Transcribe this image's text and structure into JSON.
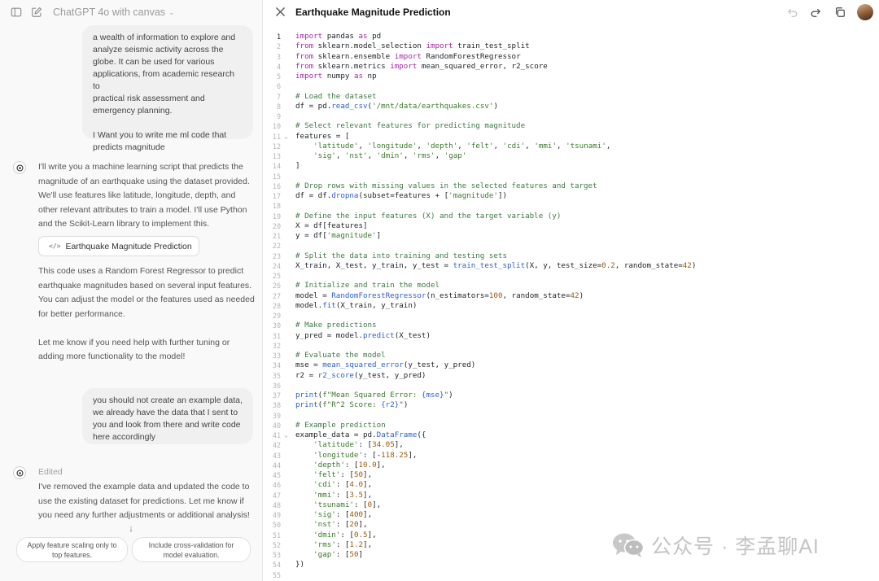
{
  "chat": {
    "model_title": "ChatGPT 4o with canvas",
    "user_message_1_lines": [
      "a wealth of information to explore and",
      "analyze seismic activity across the",
      "globe. It can be used for various",
      "applications, from academic research to",
      "practical risk assessment and",
      "emergency planning.",
      "",
      "I Want you to write me ml code that",
      "predicts magnitude"
    ],
    "assistant_message_1_lines": [
      "I'll write you a machine learning script that predicts the",
      "magnitude of an earthquake using the dataset provided.",
      "We'll use features like latitude, longitude, depth, and",
      "other relevant attributes to train a model. I'll use Python",
      "and the Scikit-Learn library to implement this."
    ],
    "canvas_chip_label": "Earthquake Magnitude Prediction",
    "assistant_message_2_lines": [
      "This code uses a Random Forest Regressor to predict",
      "earthquake magnitudes based on several input features.",
      "You can adjust the model or the features used as needed",
      "for better performance.",
      "",
      "Let me know if you need help with further tuning or",
      "adding more functionality to the model!"
    ],
    "user_message_2_lines": [
      "you should not create an example data,",
      "we already have the data that I sent to",
      "you and look from there and write code",
      "here accordingly"
    ],
    "edited_label": "Edited",
    "assistant_message_3_lines": [
      "I've removed the example data and updated the code to",
      "use the existing dataset for predictions. Let me know if",
      "you need any further adjustments or additional analysis!"
    ],
    "suggestions": [
      [
        "Apply feature scaling only to",
        "top features."
      ],
      [
        "Include cross-validation for",
        "model evaluation."
      ]
    ]
  },
  "canvas": {
    "title": "Earthquake Magnitude Prediction",
    "active_line": 1,
    "folded_lines": [
      11,
      41
    ],
    "code_lines": [
      [
        [
          "kw",
          "import"
        ],
        [
          "p",
          " pandas "
        ],
        [
          "kw",
          "as"
        ],
        [
          "p",
          " pd"
        ]
      ],
      [
        [
          "kw",
          "from"
        ],
        [
          "p",
          " sklearn.model_selection "
        ],
        [
          "kw",
          "import"
        ],
        [
          "p",
          " train_test_split"
        ]
      ],
      [
        [
          "kw",
          "from"
        ],
        [
          "p",
          " sklearn.ensemble "
        ],
        [
          "kw",
          "import"
        ],
        [
          "p",
          " RandomForestRegressor"
        ]
      ],
      [
        [
          "kw",
          "from"
        ],
        [
          "p",
          " sklearn.metrics "
        ],
        [
          "kw",
          "import"
        ],
        [
          "p",
          " mean_squared_error, r2_score"
        ]
      ],
      [
        [
          "kw",
          "import"
        ],
        [
          "p",
          " numpy "
        ],
        [
          "kw",
          "as"
        ],
        [
          "p",
          " np"
        ]
      ],
      [],
      [
        [
          "cm",
          "# Load the dataset"
        ]
      ],
      [
        [
          "p",
          "df = pd."
        ],
        [
          "fn",
          "read_csv"
        ],
        [
          "p",
          "("
        ],
        [
          "st",
          "'/mnt/data/earthquakes.csv'"
        ],
        [
          "p",
          ")"
        ]
      ],
      [],
      [
        [
          "cm",
          "# Select relevant features for predicting magnitude"
        ]
      ],
      [
        [
          "p",
          "features = ["
        ]
      ],
      [
        [
          "p",
          "    "
        ],
        [
          "st",
          "'latitude'"
        ],
        [
          "p",
          ", "
        ],
        [
          "st",
          "'longitude'"
        ],
        [
          "p",
          ", "
        ],
        [
          "st",
          "'depth'"
        ],
        [
          "p",
          ", "
        ],
        [
          "st",
          "'felt'"
        ],
        [
          "p",
          ", "
        ],
        [
          "st",
          "'cdi'"
        ],
        [
          "p",
          ", "
        ],
        [
          "st",
          "'mmi'"
        ],
        [
          "p",
          ", "
        ],
        [
          "st",
          "'tsunami'"
        ],
        [
          "p",
          ","
        ]
      ],
      [
        [
          "p",
          "    "
        ],
        [
          "st",
          "'sig'"
        ],
        [
          "p",
          ", "
        ],
        [
          "st",
          "'nst'"
        ],
        [
          "p",
          ", "
        ],
        [
          "st",
          "'dmin'"
        ],
        [
          "p",
          ", "
        ],
        [
          "st",
          "'rms'"
        ],
        [
          "p",
          ", "
        ],
        [
          "st",
          "'gap'"
        ]
      ],
      [
        [
          "p",
          "]"
        ]
      ],
      [],
      [
        [
          "cm",
          "# Drop rows with missing values in the selected features and target"
        ]
      ],
      [
        [
          "p",
          "df = df."
        ],
        [
          "fn",
          "dropna"
        ],
        [
          "p",
          "(subset=features + ["
        ],
        [
          "st",
          "'magnitude'"
        ],
        [
          "p",
          "])"
        ]
      ],
      [],
      [
        [
          "cm",
          "# Define the input features (X) and the target variable (y)"
        ]
      ],
      [
        [
          "p",
          "X = df[features]"
        ]
      ],
      [
        [
          "p",
          "y = df["
        ],
        [
          "st",
          "'magnitude'"
        ],
        [
          "p",
          "]"
        ]
      ],
      [],
      [
        [
          "cm",
          "# Split the data into training and testing sets"
        ]
      ],
      [
        [
          "p",
          "X_train, X_test, y_train, y_test = "
        ],
        [
          "fn",
          "train_test_split"
        ],
        [
          "p",
          "(X, y, test_size="
        ],
        [
          "num",
          "0.2"
        ],
        [
          "p",
          ", random_state="
        ],
        [
          "num",
          "42"
        ],
        [
          "p",
          ")"
        ]
      ],
      [],
      [
        [
          "cm",
          "# Initialize and train the model"
        ]
      ],
      [
        [
          "p",
          "model = "
        ],
        [
          "fn",
          "RandomForestRegressor"
        ],
        [
          "p",
          "(n_estimators="
        ],
        [
          "num",
          "100"
        ],
        [
          "p",
          ", random_state="
        ],
        [
          "num",
          "42"
        ],
        [
          "p",
          ")"
        ]
      ],
      [
        [
          "p",
          "model."
        ],
        [
          "fn",
          "fit"
        ],
        [
          "p",
          "(X_train, y_train)"
        ]
      ],
      [],
      [
        [
          "cm",
          "# Make predictions"
        ]
      ],
      [
        [
          "p",
          "y_pred = model."
        ],
        [
          "fn",
          "predict"
        ],
        [
          "p",
          "(X_test)"
        ]
      ],
      [],
      [
        [
          "cm",
          "# Evaluate the model"
        ]
      ],
      [
        [
          "p",
          "mse = "
        ],
        [
          "fn",
          "mean_squared_error"
        ],
        [
          "p",
          "(y_test, y_pred)"
        ]
      ],
      [
        [
          "p",
          "r2 = "
        ],
        [
          "fn",
          "r2_score"
        ],
        [
          "p",
          "(y_test, y_pred)"
        ]
      ],
      [],
      [
        [
          "fn",
          "print"
        ],
        [
          "p",
          "("
        ],
        [
          "st",
          "f\"Mean Squared Error: "
        ],
        [
          "fn",
          "{mse}"
        ],
        [
          "st",
          "\""
        ],
        [
          "p",
          ")"
        ]
      ],
      [
        [
          "fn",
          "print"
        ],
        [
          "p",
          "("
        ],
        [
          "st",
          "f\"R^2 Score: "
        ],
        [
          "fn",
          "{r2}"
        ],
        [
          "st",
          "\""
        ],
        [
          "p",
          ")"
        ]
      ],
      [],
      [
        [
          "cm",
          "# Example prediction"
        ]
      ],
      [
        [
          "p",
          "example_data = pd."
        ],
        [
          "fn",
          "DataFrame"
        ],
        [
          "p",
          "({"
        ]
      ],
      [
        [
          "p",
          "    "
        ],
        [
          "st",
          "'latitude'"
        ],
        [
          "p",
          ": ["
        ],
        [
          "num",
          "34.05"
        ],
        [
          "p",
          "],"
        ]
      ],
      [
        [
          "p",
          "    "
        ],
        [
          "st",
          "'longitude'"
        ],
        [
          "p",
          ": [-"
        ],
        [
          "num",
          "118.25"
        ],
        [
          "p",
          "],"
        ]
      ],
      [
        [
          "p",
          "    "
        ],
        [
          "st",
          "'depth'"
        ],
        [
          "p",
          ": ["
        ],
        [
          "num",
          "10.0"
        ],
        [
          "p",
          "],"
        ]
      ],
      [
        [
          "p",
          "    "
        ],
        [
          "st",
          "'felt'"
        ],
        [
          "p",
          ": ["
        ],
        [
          "num",
          "50"
        ],
        [
          "p",
          "],"
        ]
      ],
      [
        [
          "p",
          "    "
        ],
        [
          "st",
          "'cdi'"
        ],
        [
          "p",
          ": ["
        ],
        [
          "num",
          "4.0"
        ],
        [
          "p",
          "],"
        ]
      ],
      [
        [
          "p",
          "    "
        ],
        [
          "st",
          "'mmi'"
        ],
        [
          "p",
          ": ["
        ],
        [
          "num",
          "3.5"
        ],
        [
          "p",
          "],"
        ]
      ],
      [
        [
          "p",
          "    "
        ],
        [
          "st",
          "'tsunami'"
        ],
        [
          "p",
          ": ["
        ],
        [
          "num",
          "0"
        ],
        [
          "p",
          "],"
        ]
      ],
      [
        [
          "p",
          "    "
        ],
        [
          "st",
          "'sig'"
        ],
        [
          "p",
          ": ["
        ],
        [
          "num",
          "400"
        ],
        [
          "p",
          "],"
        ]
      ],
      [
        [
          "p",
          "    "
        ],
        [
          "st",
          "'nst'"
        ],
        [
          "p",
          ": ["
        ],
        [
          "num",
          "20"
        ],
        [
          "p",
          "],"
        ]
      ],
      [
        [
          "p",
          "    "
        ],
        [
          "st",
          "'dmin'"
        ],
        [
          "p",
          ": ["
        ],
        [
          "num",
          "0.5"
        ],
        [
          "p",
          "],"
        ]
      ],
      [
        [
          "p",
          "    "
        ],
        [
          "st",
          "'rms'"
        ],
        [
          "p",
          ": ["
        ],
        [
          "num",
          "1.2"
        ],
        [
          "p",
          "],"
        ]
      ],
      [
        [
          "p",
          "    "
        ],
        [
          "st",
          "'gap'"
        ],
        [
          "p",
          ": ["
        ],
        [
          "num",
          "50"
        ],
        [
          "p",
          "]"
        ]
      ],
      [
        [
          "p",
          "})"
        ]
      ],
      []
    ]
  },
  "watermark": {
    "text": "公众号 · 李孟聊AI",
    "icon": "wechat-icon"
  },
  "icons": {
    "sidebar_toggle": "sidebar-icon",
    "new_chat": "compose-icon",
    "close": "close-icon",
    "undo": "undo-icon",
    "redo": "redo-icon",
    "copy": "copy-icon"
  },
  "colors": {
    "keyword": "#a626a4",
    "function": "#2e5fcc",
    "string": "#3a7a2a",
    "number": "#9a5b10",
    "comment": "#3e7a44"
  }
}
